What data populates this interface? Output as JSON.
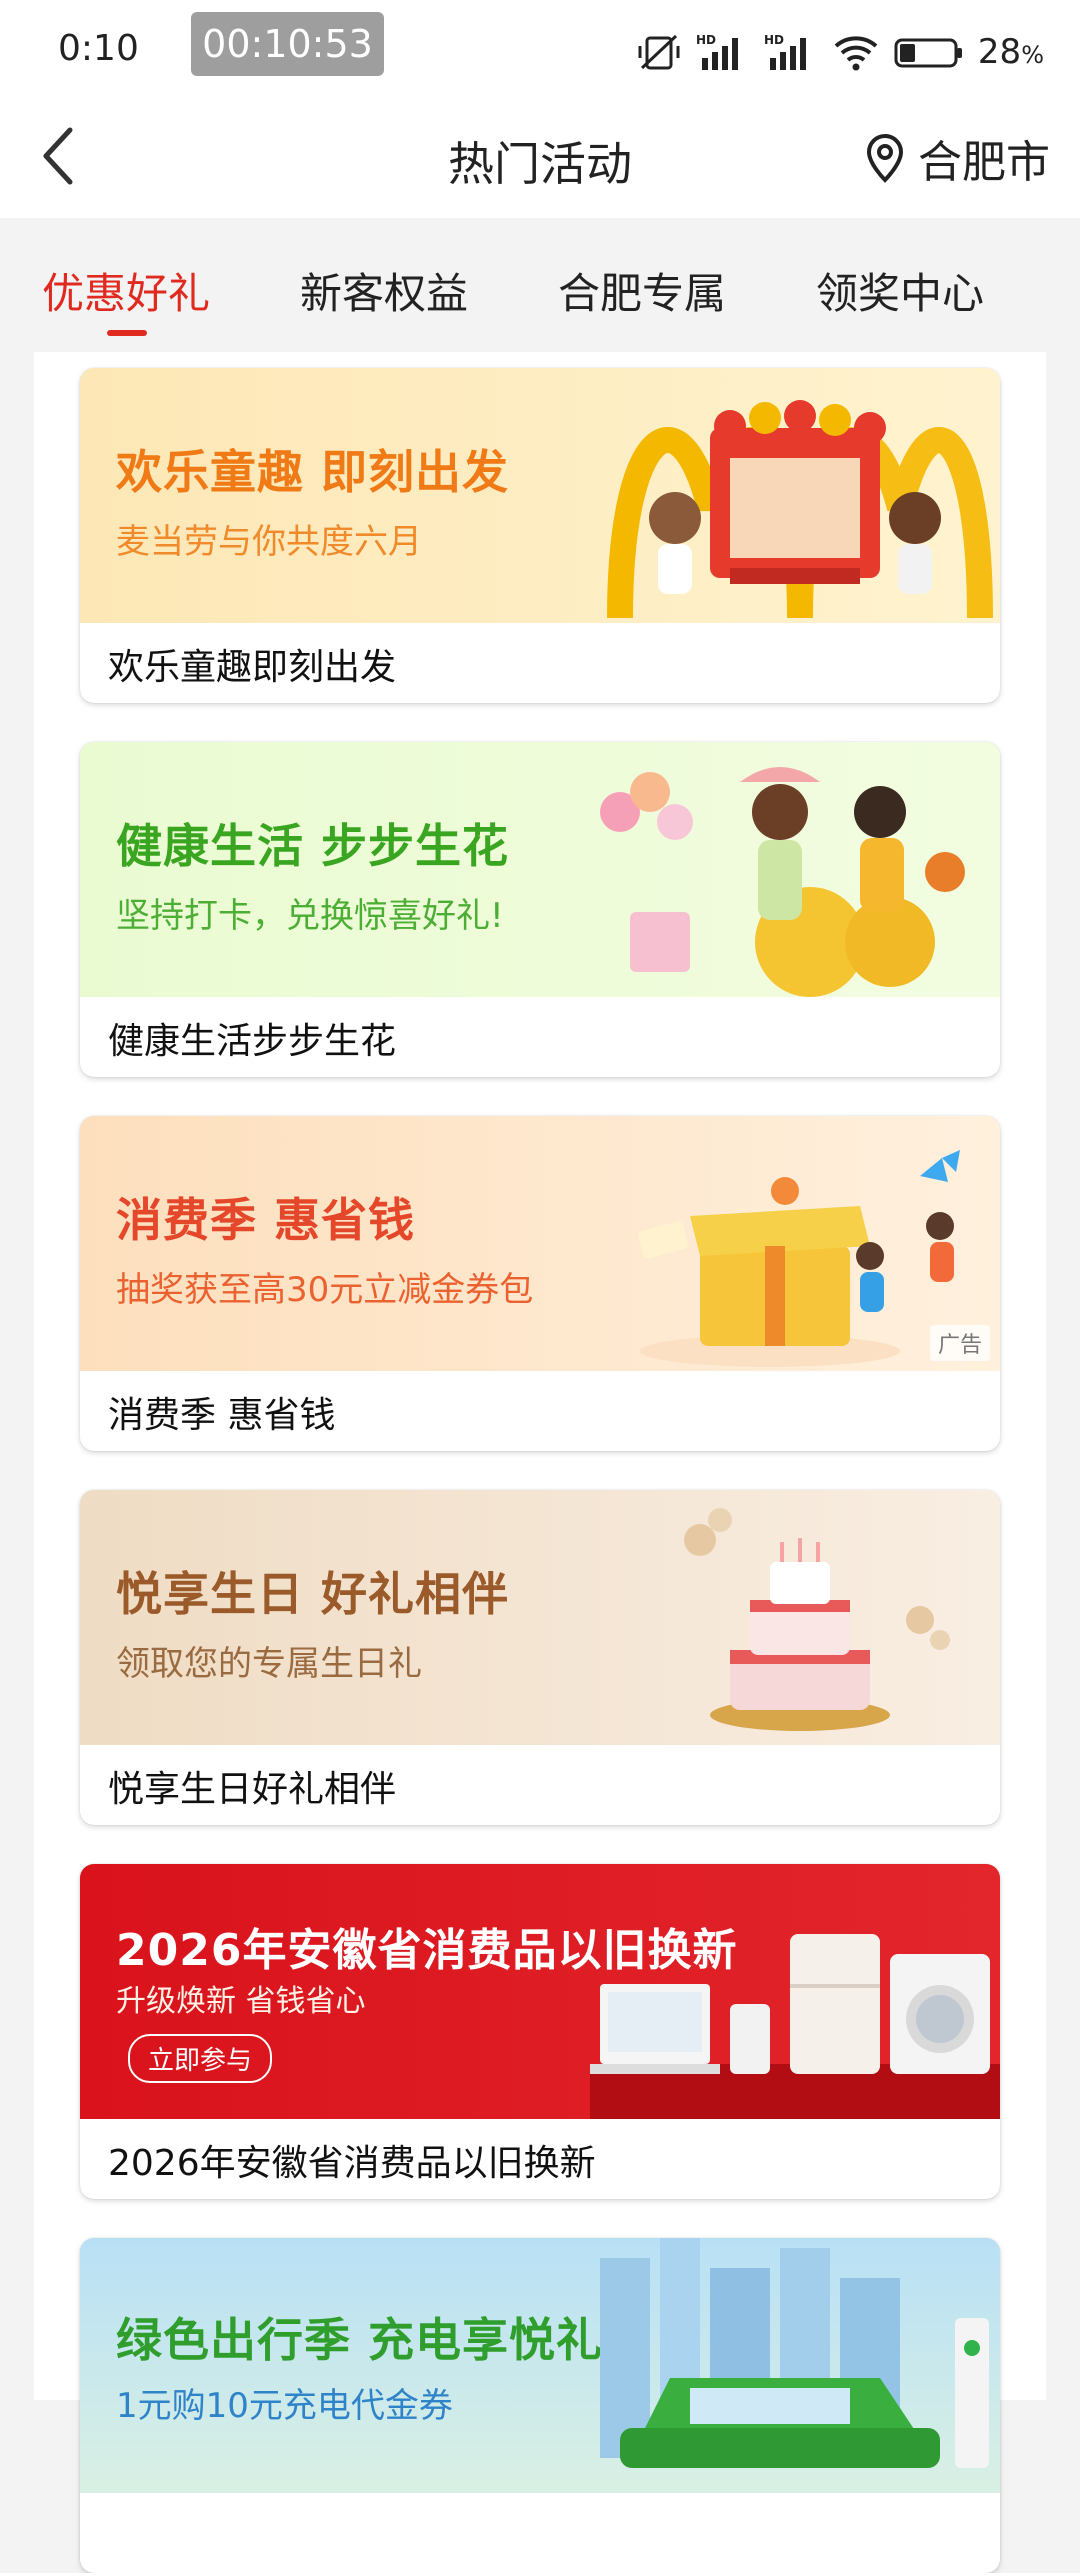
{
  "status_bar": {
    "time": "0:10",
    "timer": "00:10:53",
    "battery_percent": "28",
    "battery_unit": "%",
    "icons": [
      "mute-vibrate-icon",
      "hd-signal-icon",
      "hd-signal-icon",
      "wifi-icon",
      "battery-icon"
    ]
  },
  "header": {
    "title": "热门活动",
    "location": "合肥市",
    "back_icon": "chevron-left-icon",
    "location_icon": "location-pin-icon"
  },
  "tabs": [
    {
      "label": "优惠好礼",
      "active": true
    },
    {
      "label": "新客权益",
      "active": false
    },
    {
      "label": "合肥专属",
      "active": false
    },
    {
      "label": "领奖中心",
      "active": false
    }
  ],
  "cards": [
    {
      "banner_heading": "欢乐童趣 即刻出发",
      "banner_sub": "麦当劳与你共度六月",
      "title": "欢乐童趣即刻出发"
    },
    {
      "banner_heading": "健康生活 步步生花",
      "banner_sub": "坚持打卡，兑换惊喜好礼!",
      "title": "健康生活步步生花"
    },
    {
      "banner_heading": "消费季 惠省钱",
      "banner_sub": "抽奖获至高30元立减金券包",
      "title": "消费季 惠省钱",
      "ad_label": "广告"
    },
    {
      "banner_heading": "悦享生日 好礼相伴",
      "banner_sub": "领取您的专属生日礼",
      "title": "悦享生日好礼相伴"
    },
    {
      "banner_heading": "2026年安徽省消费品以旧换新",
      "banner_sub": "升级焕新 省钱省心",
      "button": "立即参与",
      "title": "2026年安徽省消费品以旧换新"
    },
    {
      "banner_heading": "绿色出行季 充电享悦礼",
      "banner_sub": "1元购10元充电代金券",
      "title": ""
    }
  ],
  "colors": {
    "accent": "#e02a20",
    "card1_bg": "#fde6b3",
    "card2_bg": "#eefbd6",
    "card3_bg": "#fde0c0",
    "card4_bg": "#f3e4d2",
    "card5_bg": "#d8141c",
    "card6_bg": "#bfe3f2"
  }
}
